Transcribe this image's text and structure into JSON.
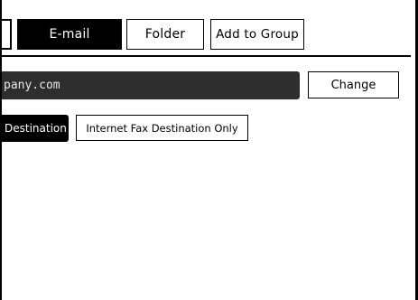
{
  "tabs": {
    "email_label": "E-mail",
    "folder_label": "Folder",
    "add_to_group_label": "Add to Group"
  },
  "email_address": {
    "value": "pany.com",
    "change_label": "Change"
  },
  "destination_type": {
    "destination_label": "Destination",
    "internet_fax_only_label": "Internet Fax Destination Only"
  },
  "colors": {
    "selected": "#000000",
    "field_bg": "#2e2e2e",
    "background": "#ffffff"
  }
}
